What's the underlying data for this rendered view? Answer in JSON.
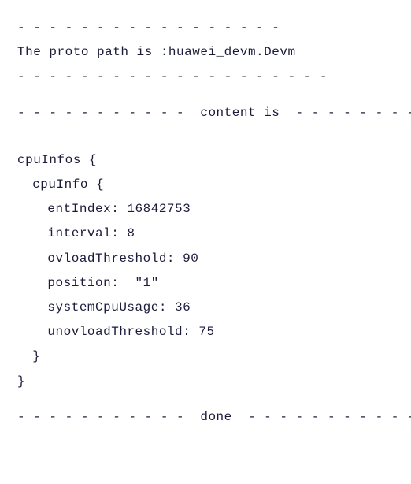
{
  "sep_top": "- - - - - - - - - - - - - - - - -",
  "proto_line": "The proto path is :huawei_devm.Devm",
  "sep_after_proto": "- - - - - - - - - - - - - - - - - - - -",
  "content_line": "- - - - - - - - - - -  content is  - - - - - - - - - - -",
  "obj_open": "cpuInfos {",
  "inner_open": "cpuInfo {",
  "fields": {
    "entIndex": "entIndex: 16842753",
    "interval": "interval: 8",
    "ovloadThreshold": "ovloadThreshold: 90",
    "position": "position:  \"1\"",
    "systemCpuUsage": "systemCpuUsage: 36",
    "unovloadThreshold": "unovloadThreshold: 75"
  },
  "inner_close": "}",
  "obj_close": "}",
  "done_line": "- - - - - - - - - - -  done  - - - - - - - - - - - - - - - -",
  "chart_data": {
    "type": "table",
    "title": "cpuInfo",
    "proto_path": "huawei_devm.Devm",
    "fields": [
      {
        "name": "entIndex",
        "value": 16842753
      },
      {
        "name": "interval",
        "value": 8
      },
      {
        "name": "ovloadThreshold",
        "value": 90
      },
      {
        "name": "position",
        "value": "1"
      },
      {
        "name": "systemCpuUsage",
        "value": 36
      },
      {
        "name": "unovloadThreshold",
        "value": 75
      }
    ]
  }
}
